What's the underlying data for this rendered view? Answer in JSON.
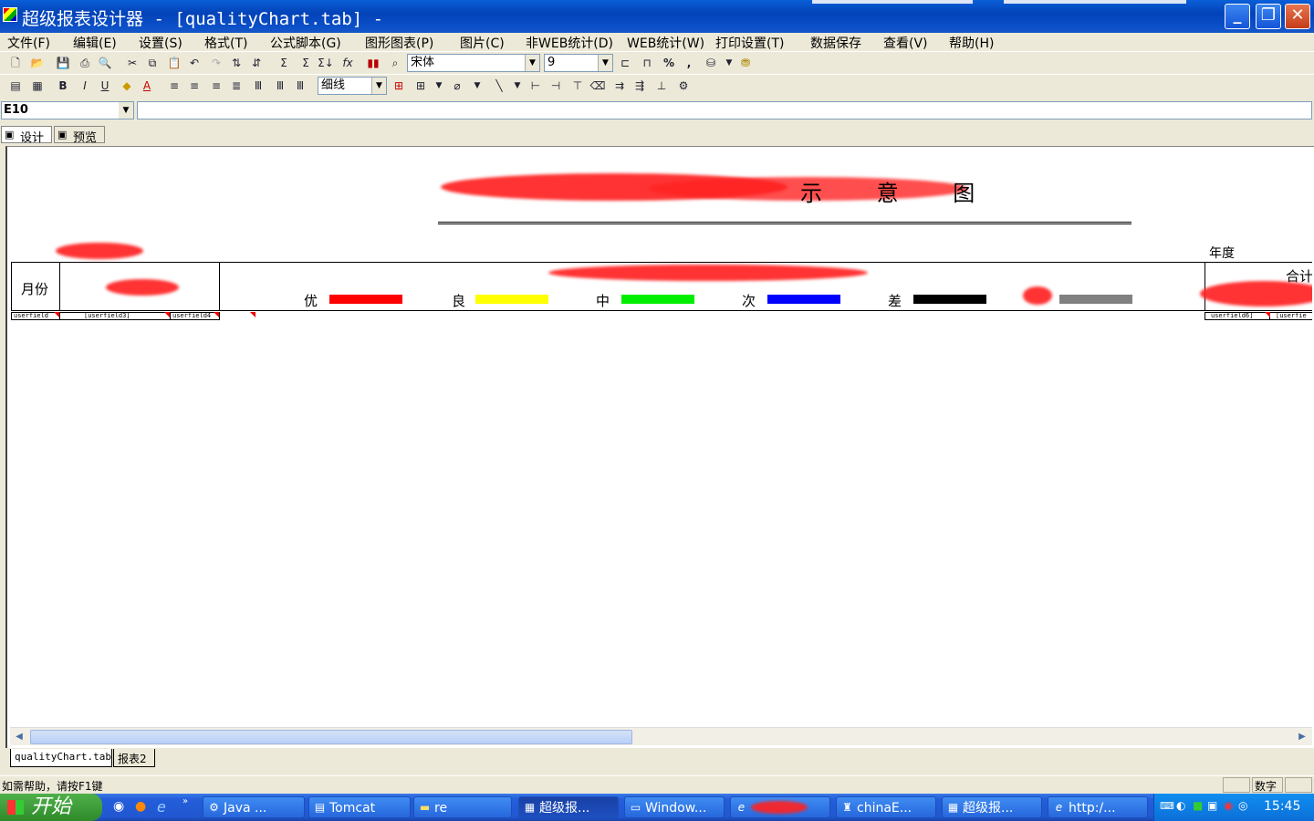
{
  "window": {
    "title": "超级报表设计器 - [qualityChart.tab] -",
    "minimize": "_",
    "maximize": "❐",
    "close": "✕"
  },
  "menu": [
    "文件(F)",
    "编辑(E)",
    "设置(S)",
    "格式(T)",
    "公式脚本(G)",
    "图形图表(P)",
    "图片(C)",
    "非WEB统计(D)",
    "WEB统计(W)",
    "打印设置(T)",
    "数据保存",
    "查看(V)",
    "帮助(H)"
  ],
  "toolbar1": {
    "font_name": "宋体",
    "font_size": "9"
  },
  "toolbar2": {
    "line_style": "细线"
  },
  "formula": {
    "cell_ref": "E10",
    "value": ""
  },
  "view_tabs": [
    "设计",
    "预览"
  ],
  "report": {
    "title_visible": "示 意 图",
    "year_label": "年度",
    "total_label": "合计",
    "month_label": "月份",
    "legend": [
      {
        "label": "优",
        "color": "#ff0000"
      },
      {
        "label": "良",
        "color": "#ffff00"
      },
      {
        "label": "中",
        "color": "#00ee00"
      },
      {
        "label": "次",
        "color": "#0000ff"
      },
      {
        "label": "差",
        "color": "#000000"
      },
      {
        "label": "",
        "color": "#808080"
      }
    ],
    "data_cells": [
      "userfield",
      "[userfield3]",
      "userfield4",
      "userfield6]",
      "[userfie"
    ]
  },
  "sheets": [
    "qualityChart.tab",
    "报表2"
  ],
  "status": {
    "help": "如需帮助，请按F1键",
    "mode": "数字"
  },
  "taskbar": {
    "start": "开始",
    "tasks": [
      "Java ...",
      "Tomcat",
      "re",
      "超级报...",
      "Window...",
      "",
      "chinaE...",
      "超级报...",
      "http:/..."
    ],
    "clock": "15:45"
  }
}
